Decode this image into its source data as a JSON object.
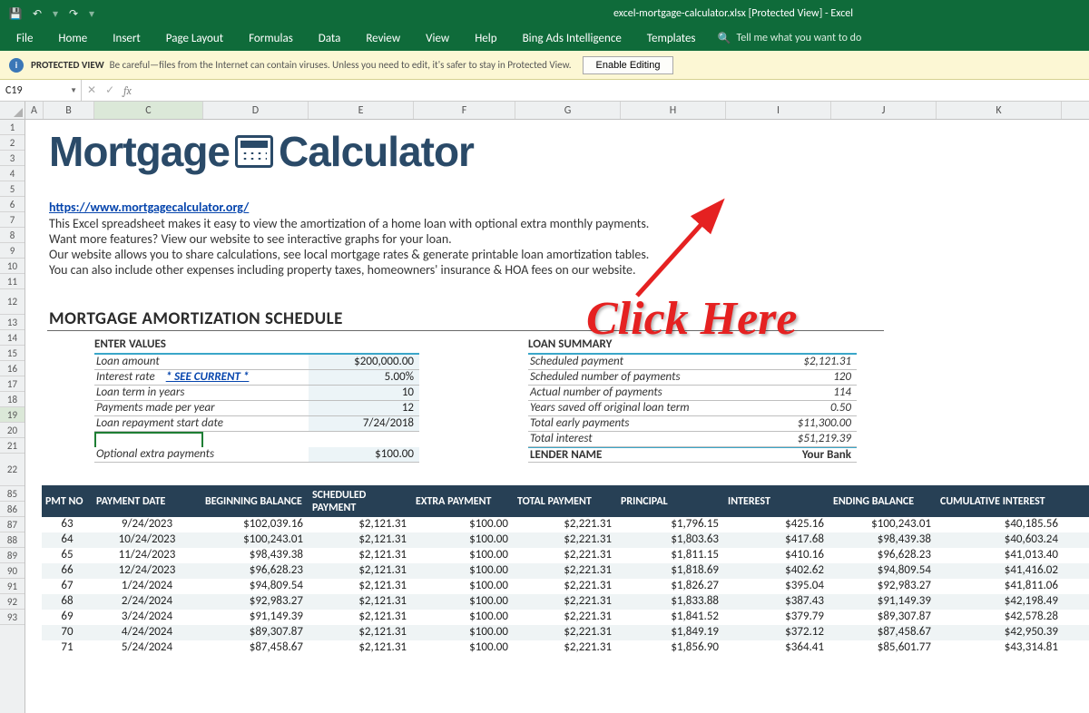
{
  "window": {
    "filename": "excel-mortgage-calculator.xlsx",
    "mode": "[Protected View]",
    "app": "Excel",
    "full_title": "excel-mortgage-calculator.xlsx  [Protected View]  -  Excel"
  },
  "ribbon_tabs": [
    "File",
    "Home",
    "Insert",
    "Page Layout",
    "Formulas",
    "Data",
    "Review",
    "View",
    "Help",
    "Bing Ads Intelligence",
    "Templates"
  ],
  "tellme": "Tell me what you want to do",
  "protected_view": {
    "label": "PROTECTED VIEW",
    "msg": "Be careful—files from the Internet can contain viruses. Unless you need to edit, it's safer to stay in Protected View.",
    "button": "Enable Editing"
  },
  "namebox": "C19",
  "columns": [
    "A",
    "B",
    "C",
    "D",
    "E",
    "F",
    "G",
    "H",
    "I",
    "J",
    "K"
  ],
  "row_headers_top": [
    "1",
    "2",
    "3",
    "4",
    "5",
    "6",
    "7",
    "8",
    "9",
    "10",
    "11",
    "12",
    "13",
    "14",
    "15",
    "16",
    "17",
    "18",
    "19",
    "20",
    "21",
    "22"
  ],
  "row_headers_data": [
    "85",
    "86",
    "87",
    "88",
    "89",
    "90",
    "91",
    "92",
    "93"
  ],
  "logo_text1": "Mortgage",
  "logo_text2": "Calculator",
  "url": "https://www.mortgagecalculator.org/",
  "desc1": "This Excel spreadsheet makes it easy to view the amortization of a home loan with optional extra monthly payments.",
  "desc2": "Want more features? View our website to see interactive graphs for your loan.",
  "desc3": "Our website allows you to share calculations, see local mortgage rates & generate printable loan amortization tables.",
  "desc4": "You can also include other expenses including property taxes, homeowners' insurance & HOA fees on our website.",
  "sched_title": "MORTGAGE AMORTIZATION SCHEDULE",
  "enter_values": {
    "header": "ENTER VALUES",
    "rows": [
      {
        "label": "Loan amount",
        "value": "$200,000.00"
      },
      {
        "label": "Interest rate",
        "link": "* SEE CURRENT *",
        "value": "5.00%"
      },
      {
        "label": "Loan term in years",
        "value": "10"
      },
      {
        "label": "Payments made per year",
        "value": "12"
      },
      {
        "label": "Loan repayment start date",
        "value": "7/24/2018"
      }
    ],
    "optional_label": "Optional extra payments",
    "optional_value": "$100.00"
  },
  "loan_summary": {
    "header": "LOAN SUMMARY",
    "rows": [
      {
        "label": "Scheduled payment",
        "value": "$2,121.31"
      },
      {
        "label": "Scheduled number of payments",
        "value": "120"
      },
      {
        "label": "Actual number of payments",
        "value": "114"
      },
      {
        "label": "Years saved off original loan term",
        "value": "0.50"
      },
      {
        "label": "Total early payments",
        "value": "$11,300.00"
      },
      {
        "label": "Total interest",
        "value": "$51,219.39"
      }
    ],
    "lender_label": "LENDER NAME",
    "lender_value": "Your Bank"
  },
  "table_headers": {
    "no": "PMT NO",
    "date": "PAYMENT DATE",
    "beg": "BEGINNING BALANCE",
    "sched": "SCHEDULED PAYMENT",
    "extra": "EXTRA PAYMENT",
    "tot": "TOTAL PAYMENT",
    "prin": "PRINCIPAL",
    "int": "INTEREST",
    "end": "ENDING BALANCE",
    "cum": "CUMULATIVE INTEREST"
  },
  "table_rows": [
    {
      "no": "63",
      "date": "9/24/2023",
      "beg": "$102,039.16",
      "sched": "$2,121.31",
      "extra": "$100.00",
      "tot": "$2,221.31",
      "prin": "$1,796.15",
      "int": "$425.16",
      "end": "$100,243.01",
      "cum": "$40,185.56"
    },
    {
      "no": "64",
      "date": "10/24/2023",
      "beg": "$100,243.01",
      "sched": "$2,121.31",
      "extra": "$100.00",
      "tot": "$2,221.31",
      "prin": "$1,803.63",
      "int": "$417.68",
      "end": "$98,439.38",
      "cum": "$40,603.24"
    },
    {
      "no": "65",
      "date": "11/24/2023",
      "beg": "$98,439.38",
      "sched": "$2,121.31",
      "extra": "$100.00",
      "tot": "$2,221.31",
      "prin": "$1,811.15",
      "int": "$410.16",
      "end": "$96,628.23",
      "cum": "$41,013.40"
    },
    {
      "no": "66",
      "date": "12/24/2023",
      "beg": "$96,628.23",
      "sched": "$2,121.31",
      "extra": "$100.00",
      "tot": "$2,221.31",
      "prin": "$1,818.69",
      "int": "$402.62",
      "end": "$94,809.54",
      "cum": "$41,416.02"
    },
    {
      "no": "67",
      "date": "1/24/2024",
      "beg": "$94,809.54",
      "sched": "$2,121.31",
      "extra": "$100.00",
      "tot": "$2,221.31",
      "prin": "$1,826.27",
      "int": "$395.04",
      "end": "$92,983.27",
      "cum": "$41,811.06"
    },
    {
      "no": "68",
      "date": "2/24/2024",
      "beg": "$92,983.27",
      "sched": "$2,121.31",
      "extra": "$100.00",
      "tot": "$2,221.31",
      "prin": "$1,833.88",
      "int": "$387.43",
      "end": "$91,149.39",
      "cum": "$42,198.49"
    },
    {
      "no": "69",
      "date": "3/24/2024",
      "beg": "$91,149.39",
      "sched": "$2,121.31",
      "extra": "$100.00",
      "tot": "$2,221.31",
      "prin": "$1,841.52",
      "int": "$379.79",
      "end": "$89,307.87",
      "cum": "$42,578.28"
    },
    {
      "no": "70",
      "date": "4/24/2024",
      "beg": "$89,307.87",
      "sched": "$2,121.31",
      "extra": "$100.00",
      "tot": "$2,221.31",
      "prin": "$1,849.19",
      "int": "$372.12",
      "end": "$87,458.67",
      "cum": "$42,950.39"
    },
    {
      "no": "71",
      "date": "5/24/2024",
      "beg": "$87,458.67",
      "sched": "$2,121.31",
      "extra": "$100.00",
      "tot": "$2,221.31",
      "prin": "$1,856.90",
      "int": "$364.41",
      "end": "$85,601.77",
      "cum": "$43,314.81"
    }
  ],
  "annotation": "Click Here"
}
